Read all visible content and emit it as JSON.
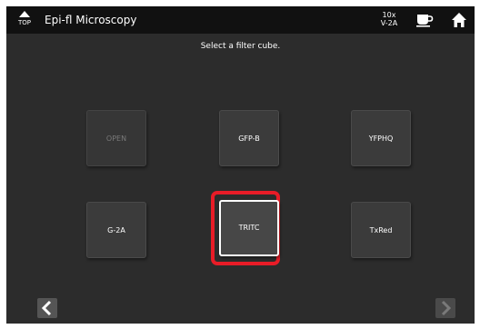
{
  "titlebar": {
    "top_label": "TOP",
    "title": "Epi-fl Microscopy",
    "objective_magnification": "10x",
    "objective_filter": "V-2A",
    "icons": [
      "top-arrow-icon",
      "coffee-cup-icon",
      "home-icon"
    ]
  },
  "instruction": "Select a filter cube.",
  "filters": [
    {
      "label": "OPEN",
      "state": "disabled"
    },
    {
      "label": "GFP-B",
      "state": "normal"
    },
    {
      "label": "YFPHQ",
      "state": "normal"
    },
    {
      "label": "G-2A",
      "state": "normal"
    },
    {
      "label": "TRITC",
      "state": "selected"
    },
    {
      "label": "TxRed",
      "state": "normal"
    }
  ],
  "navigation": {
    "prev_icon": "chevron-left-icon",
    "next_icon": "chevron-right-icon",
    "next_enabled": false
  },
  "colors": {
    "background": "#2c2c2c",
    "titlebar": "#111111",
    "selection_highlight": "#e81c27",
    "text": "#ffffff"
  }
}
